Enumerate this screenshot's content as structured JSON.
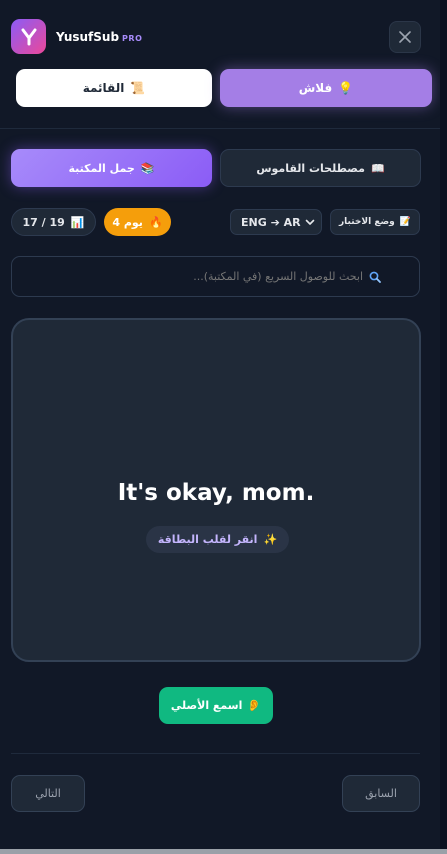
{
  "header": {
    "brand": "YusufSub",
    "badge": "PRO",
    "logo_icon": "y-logo-icon",
    "close_icon": "close-icon"
  },
  "modes": {
    "flash_label": "فلاش",
    "flash_icon": "💡",
    "list_label": "القائمة",
    "list_icon": "📜",
    "active": "flash"
  },
  "sources": {
    "dictionary_label": "مصطلحات القاموس",
    "dictionary_icon": "📖",
    "library_label": "جمل المكتبة",
    "library_icon": "📚",
    "active": "library"
  },
  "stats": {
    "counter": "17 / 19",
    "counter_icon": "📊",
    "streak": "يوم 4",
    "streak_icon": "🔥",
    "language": "ENG ➔ AR",
    "quiz_label": "وضع الاختبار",
    "quiz_icon": "📝"
  },
  "search": {
    "placeholder": "ابحث للوصول السريع (في المكتبة)...",
    "value": ""
  },
  "card": {
    "text": "It's okay, mom.",
    "flip_hint": "انقر لقلب البطاقة",
    "flip_icon": "✨"
  },
  "actions": {
    "listen_label": "اسمع الأصلي",
    "listen_icon": "👂",
    "next_label": "التالي",
    "prev_label": "السابق"
  },
  "colors": {
    "background": "#111827",
    "accent_purple": "#a47ee6",
    "streak_orange": "#f59e0b",
    "listen_green": "#10b981",
    "card_bg": "#1f2937"
  }
}
